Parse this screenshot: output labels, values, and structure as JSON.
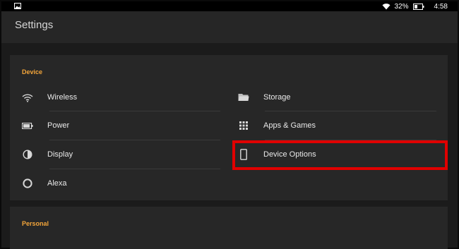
{
  "status_bar": {
    "battery_percent": "32%",
    "time": "4:58",
    "icons": [
      "gallery-icon",
      "wifi-icon",
      "battery-icon"
    ]
  },
  "header": {
    "title": "Settings"
  },
  "sections": {
    "device": {
      "label": "Device",
      "items": [
        {
          "label": "Wireless",
          "icon": "wifi-icon"
        },
        {
          "label": "Power",
          "icon": "battery-icon"
        },
        {
          "label": "Display",
          "icon": "half-circle-icon"
        },
        {
          "label": "Alexa",
          "icon": "alexa-ring-icon"
        },
        {
          "label": "Storage",
          "icon": "folder-icon"
        },
        {
          "label": "Apps & Games",
          "icon": "grid-icon"
        },
        {
          "label": "Device Options",
          "icon": "tablet-icon"
        }
      ]
    },
    "personal": {
      "label": "Personal"
    }
  },
  "colors": {
    "accent": "#f3a53a",
    "highlight": "#e00000",
    "background": "#1b1b1b",
    "card": "#272727"
  }
}
